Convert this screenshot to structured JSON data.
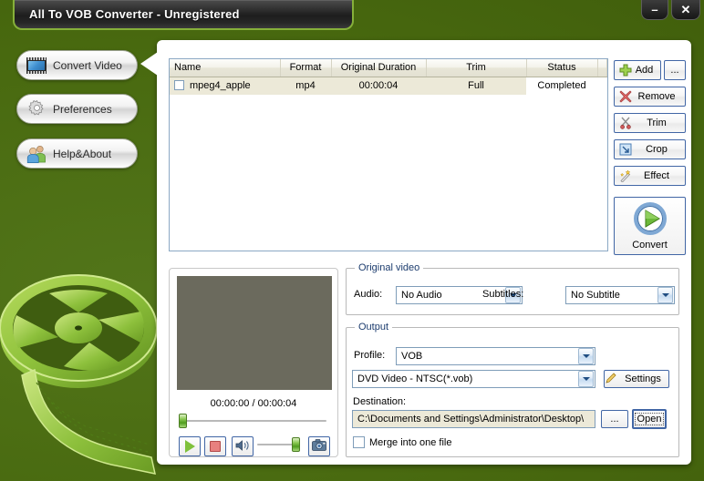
{
  "window": {
    "title": "All To VOB Converter - Unregistered",
    "minimize_label": "–",
    "close_label": "✕"
  },
  "sidebar": {
    "items": [
      {
        "label": "Convert Video",
        "icon": "film-icon"
      },
      {
        "label": "Preferences",
        "icon": "gear-icon"
      },
      {
        "label": "Help&About",
        "icon": "people-icon"
      }
    ]
  },
  "filelist": {
    "columns": [
      "Name",
      "Format",
      "Original Duration",
      "Trim",
      "Status"
    ],
    "rows": [
      {
        "checked": false,
        "name": "mpeg4_apple",
        "format": "mp4",
        "duration": "00:00:04",
        "trim": "Full",
        "status": "Completed"
      }
    ]
  },
  "actions": {
    "add": "Add",
    "more": "...",
    "remove": "Remove",
    "trim": "Trim",
    "crop": "Crop",
    "effect": "Effect",
    "convert": "Convert"
  },
  "preview": {
    "time": "00:00:00 / 00:00:04",
    "current_time": "00:00:00",
    "total_time": "00:00:04",
    "seek_percent": 0,
    "volume_percent": 86,
    "play_label": "play-icon",
    "stop_label": "stop-icon",
    "mute_label": "speaker-icon",
    "snapshot_label": "camera-icon"
  },
  "original_video": {
    "group_title": "Original video",
    "audio_label": "Audio:",
    "audio_value": "No Audio",
    "subtitles_label": "Subtitles:",
    "subtitles_value": "No Subtitle"
  },
  "output": {
    "group_title": "Output",
    "profile_label": "Profile:",
    "profile_value": "VOB",
    "format_value": "DVD Video - NTSC(*.vob)",
    "settings_label": "Settings",
    "destination_label": "Destination:",
    "destination_value": "C:\\Documents and Settings\\Administrator\\Desktop\\",
    "browse_label": "...",
    "open_label": "Open",
    "merge_label": "Merge into one file",
    "merge_checked": false
  },
  "colors": {
    "background_green": "#4a6d13",
    "titlebar_dark": "#1d1d1d",
    "panel_white": "#ffffff",
    "row_highlight": "#ece9d8",
    "button_border_blue": "#4166a5",
    "video_surface": "#6b6a5d"
  }
}
